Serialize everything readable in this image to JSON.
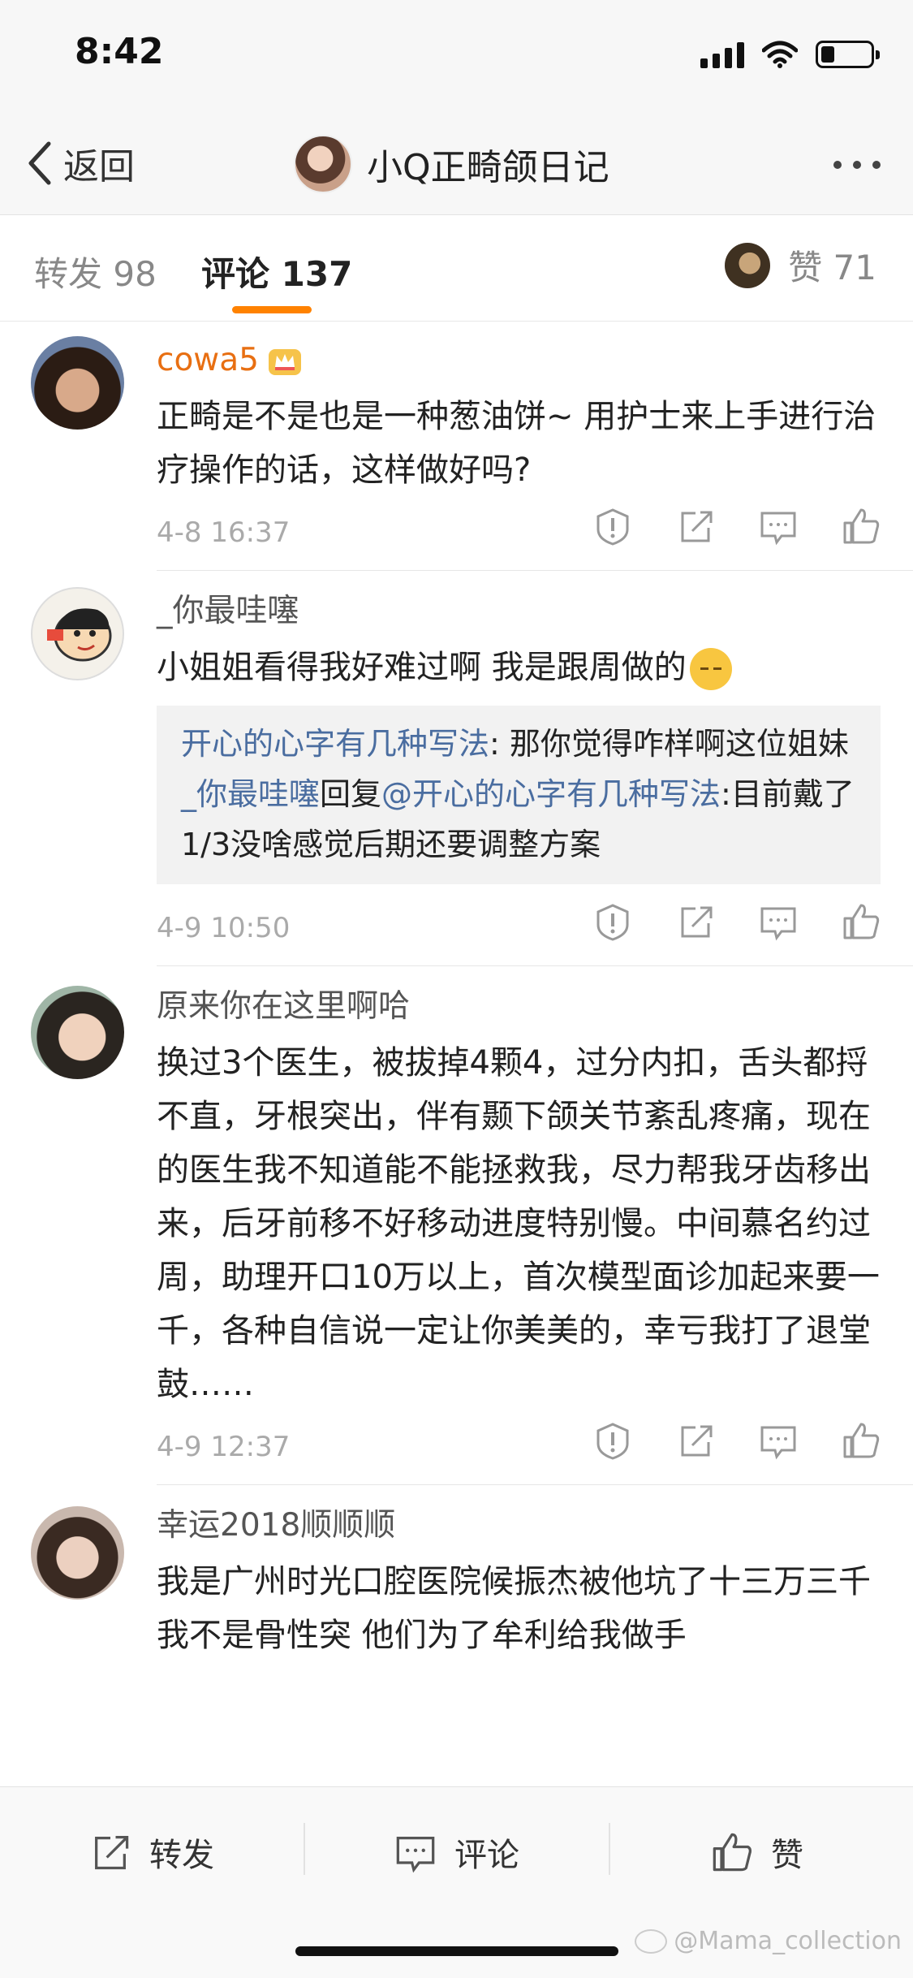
{
  "status_bar": {
    "time": "8:42"
  },
  "nav": {
    "back_label": "返回",
    "title": "小Q正畸颌日记"
  },
  "tabs": {
    "repost": "转发 98",
    "comments": "评论 137",
    "likes": "赞 71"
  },
  "comments": [
    {
      "username": "cowa5",
      "vip": true,
      "text": "正畸是不是也是一种葱油饼~ 用护士来上手进行治疗操作的话，这样做好吗?",
      "time": "4-8 16:37"
    },
    {
      "username": "_你最哇噻",
      "text": "小姐姐看得我好难过啊 我是跟周做的",
      "emoji": "sad-face-emoji",
      "replies": [
        {
          "name": "开心的心字有几种写法",
          "text": ": 那你觉得咋样啊这位姐妹"
        },
        {
          "name": "_你最哇噻",
          "middle": "回复",
          "mention": "@开心的心字有几种写法",
          "text": ":目前戴了1/3没啥感觉后期还要调整方案"
        }
      ],
      "time": "4-9 10:50"
    },
    {
      "username": "原来你在这里啊哈",
      "text": "换过3个医生，被拔掉4颗4，过分内扣，舌头都捋不直，牙根突出，伴有颞下颌关节紊乱疼痛，现在的医生我不知道能不能拯救我，尽力帮我牙齿移出来，后牙前移不好移动进度特别慢。中间慕名约过周，助理开口10万以上，首次模型面诊加起来要一千，各种自信说一定让你美美的，幸亏我打了退堂鼓……",
      "time": "4-9 12:37"
    },
    {
      "username": "幸运2018顺顺顺",
      "text": "我是广州时光口腔医院候振杰被他坑了十三万三千 我不是骨性突 他们为了牟利给我做手"
    }
  ],
  "bottom_bar": {
    "repost": "转发",
    "comment": "评论",
    "like": "赞"
  },
  "watermark": "@Mama_collection",
  "colors": {
    "accent": "#ff8200",
    "link": "#4a6da0",
    "vip_name": "#e86f12"
  }
}
